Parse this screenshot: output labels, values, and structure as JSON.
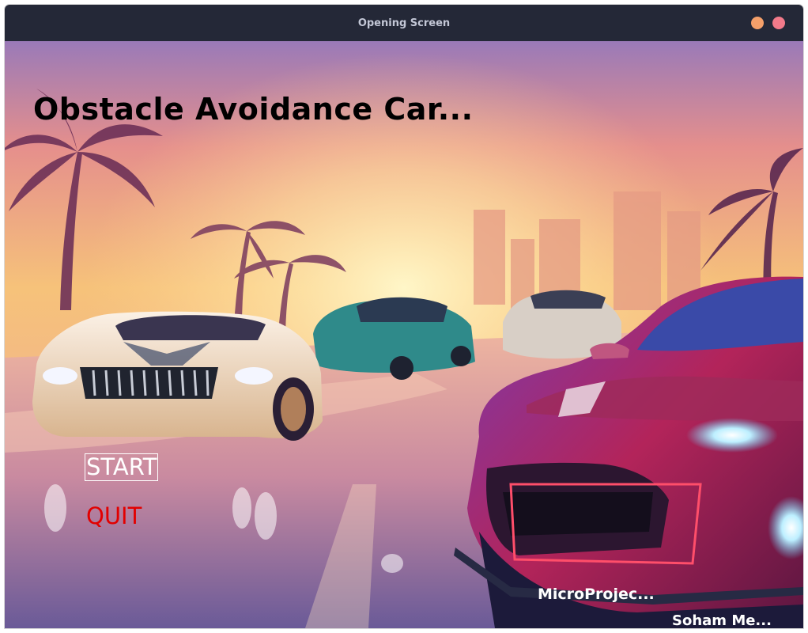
{
  "window": {
    "title": "Opening Screen"
  },
  "game": {
    "title": "Obstacle Avoidance Car...",
    "menu": {
      "start_label": "START",
      "quit_label": "QUIT"
    },
    "credits": {
      "project": "MicroProjec...",
      "author": "Soham Me..."
    }
  },
  "colors": {
    "titlebar": "#242837",
    "minimize_button": "#f5a06a",
    "close_button": "#f27a8a",
    "start_text": "#ffffff",
    "quit_text": "#e20000"
  }
}
